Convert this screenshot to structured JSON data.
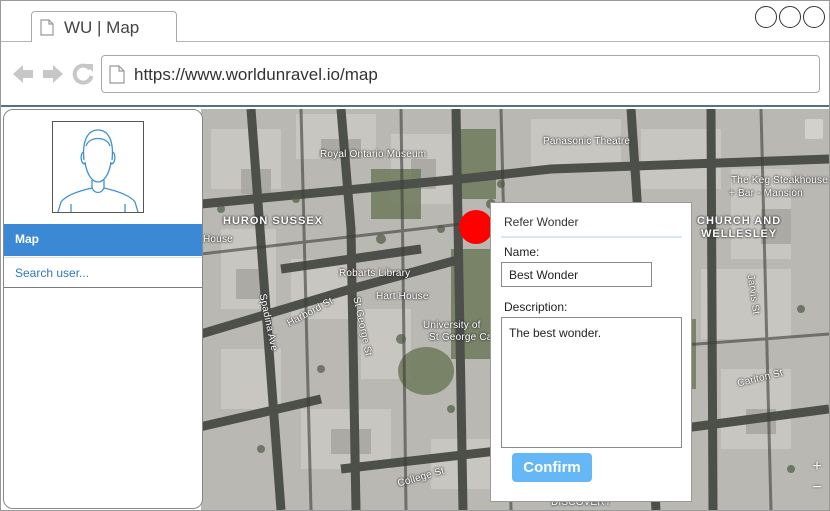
{
  "browser": {
    "tab_title": "WU | Map",
    "url": "https://www.worldunravel.io/map"
  },
  "sidebar": {
    "items": [
      {
        "label": "Map",
        "active": true
      },
      {
        "label": "Search user...",
        "active": false
      }
    ]
  },
  "map": {
    "labels": {
      "royal_ontario_museum": "Royal Ontario Museum",
      "panasonic_theatre": "Panasonic Theatre",
      "keg_steakhouse_1": "The Keg Steakhouse",
      "keg_steakhouse_2": "+ Bar - Mansion",
      "huron_sussex": "HURON SUSSEX",
      "church_wellesley_1": "CHURCH AND",
      "church_wellesley_2": "WELLESLEY",
      "robarts_library": "Robarts Library",
      "hart_house": "Hart House",
      "uoft_1": "University of",
      "uoft_2": "St George Ca",
      "harbord_st": "Harbord St",
      "st_george_st": "St George St",
      "spadina_ave": "Spadina Ave",
      "college_st": "College St",
      "carlton_st": "Carlton St",
      "jarvis_st": "Jarvis St",
      "house": "House",
      "discovery": "DISCOVERY"
    },
    "zoom_in": "+",
    "zoom_out": "−"
  },
  "popup": {
    "title": "Refer Wonder",
    "name_label": "Name:",
    "name_value": "Best Wonder",
    "description_label": "Description:",
    "description_value": "The best wonder.",
    "confirm_label": "Confirm"
  },
  "colors": {
    "accent": "#3b88d4",
    "link": "#2e77c9",
    "confirm": "#66b7f5",
    "marker": "#ff0000"
  }
}
